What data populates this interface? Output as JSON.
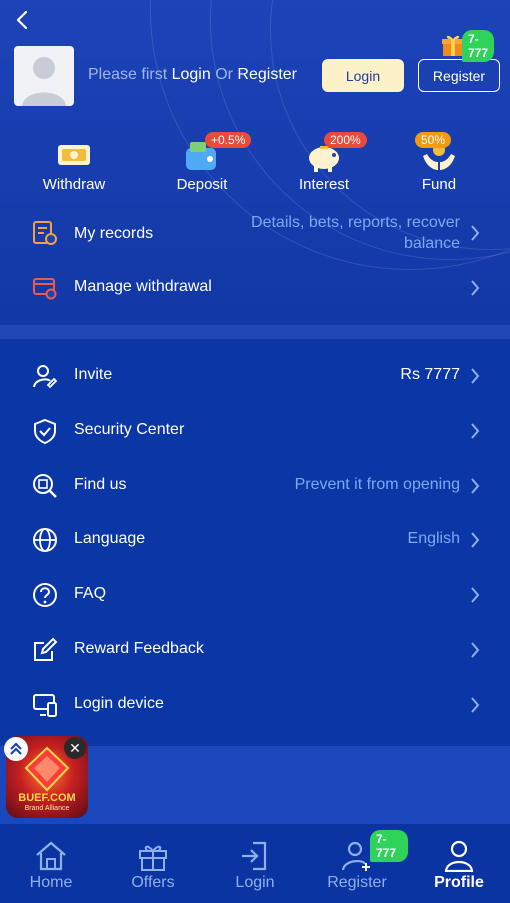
{
  "header": {
    "login_prompt_prefix": "Please first ",
    "login_prompt_login": "Login",
    "login_prompt_or": " Or ",
    "login_prompt_register": "Register",
    "login_button": "Login",
    "register_button": "Register",
    "gift_badge": "7-777"
  },
  "quick_actions": [
    {
      "label": "Withdraw",
      "icon": "ticket-icon"
    },
    {
      "label": "Deposit",
      "icon": "wallet-icon",
      "tag": "+0.5%"
    },
    {
      "label": "Interest",
      "icon": "piggy-bank-icon",
      "tag": "200%"
    },
    {
      "label": "Fund",
      "icon": "hands-icon",
      "tag": "50%"
    }
  ],
  "records": {
    "label": "My records",
    "value_line1": "Details, bets, reports, recover",
    "value_line2": "balance"
  },
  "manage_withdrawal": {
    "label": "Manage withdrawal"
  },
  "menu": [
    {
      "label": "Invite",
      "value": "Rs 7777",
      "icon": "invite-user-icon"
    },
    {
      "label": "Security Center",
      "value": "",
      "icon": "shield-check-icon"
    },
    {
      "label": "Find us",
      "value": "Prevent it from opening",
      "icon": "search-doc-icon"
    },
    {
      "label": "Language",
      "value": "English",
      "icon": "globe-icon"
    },
    {
      "label": "FAQ",
      "value": "",
      "icon": "question-icon"
    },
    {
      "label": "Reward Feedback",
      "value": "",
      "icon": "edit-icon"
    },
    {
      "label": "Login device",
      "value": "",
      "icon": "devices-icon"
    }
  ],
  "float_ad": {
    "brand": "BUEF.COM",
    "sub": "Brand Alliance"
  },
  "tabbar": {
    "items": [
      {
        "label": "Home",
        "icon": "home-icon"
      },
      {
        "label": "Offers",
        "icon": "gift-icon"
      },
      {
        "label": "Login",
        "icon": "login-icon"
      },
      {
        "label": "Register",
        "icon": "add-user-icon",
        "badge": "7-777"
      },
      {
        "label": "Profile",
        "icon": "profile-icon",
        "active": true
      }
    ]
  },
  "colors": {
    "accent_value": "#78aaf5",
    "background": "#0b37a6",
    "badge_green": "#2ed35a",
    "badge_red": "#e84a3c",
    "badge_orange": "#f29a12"
  }
}
